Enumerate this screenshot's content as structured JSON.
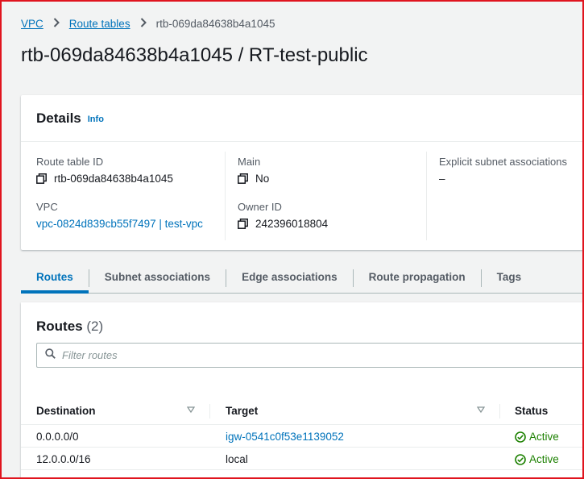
{
  "breadcrumb": {
    "vpc": "VPC",
    "route_tables": "Route tables",
    "current": "rtb-069da84638b4a1045"
  },
  "page_title": "rtb-069da84638b4a1045 / RT-test-public",
  "details": {
    "title": "Details",
    "info": "Info",
    "route_table_id_label": "Route table ID",
    "route_table_id_value": "rtb-069da84638b4a1045",
    "main_label": "Main",
    "main_value": "No",
    "explicit_label": "Explicit subnet associations",
    "explicit_value": "–",
    "vpc_label": "VPC",
    "vpc_value": "vpc-0824d839cb55f7497 | test-vpc",
    "owner_label": "Owner ID",
    "owner_value": "242396018804"
  },
  "tabs": [
    {
      "label": "Routes",
      "active": true
    },
    {
      "label": "Subnet associations",
      "active": false
    },
    {
      "label": "Edge associations",
      "active": false
    },
    {
      "label": "Route propagation",
      "active": false
    },
    {
      "label": "Tags",
      "active": false
    }
  ],
  "routes": {
    "title": "Routes",
    "count": "(2)",
    "search_placeholder": "Filter routes",
    "columns": [
      "Destination",
      "Target",
      "Status"
    ],
    "rows": [
      {
        "destination": "0.0.0.0/0",
        "target": "igw-0541c0f53e1139052",
        "target_is_link": true,
        "status": "Active"
      },
      {
        "destination": "12.0.0.0/16",
        "target": "local",
        "target_is_link": false,
        "status": "Active"
      }
    ]
  },
  "colors": {
    "link": "#0073bb",
    "active_status": "#1d8102",
    "frame": "#e0141e"
  }
}
